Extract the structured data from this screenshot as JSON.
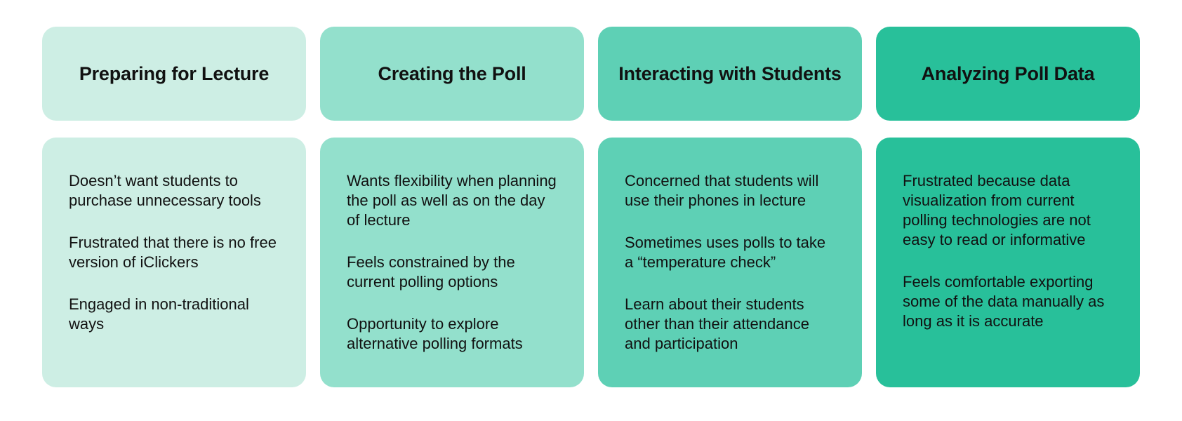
{
  "colors": {
    "stage_1": "#cdeee4",
    "stage_2": "#93e0cc",
    "stage_3": "#5ed0b5",
    "stage_4": "#28c09a"
  },
  "stages": [
    {
      "title": "Preparing for Lecture",
      "notes": [
        "Doesn’t want students to purchase unnecessary tools",
        "Frustrated that there is no free version of iClickers",
        "Engaged in non-traditional ways"
      ]
    },
    {
      "title": "Creating the Poll",
      "notes": [
        "Wants flexibility when planning the poll as well as on the day of lecture",
        "Feels constrained by the current polling options",
        "Opportunity to explore alternative polling formats"
      ]
    },
    {
      "title": "Interacting with Students",
      "notes": [
        "Concerned that students will use their phones in lecture",
        "Sometimes uses polls to take a “temperature check”",
        "Learn about their students other than their attendance and participation"
      ]
    },
    {
      "title": "Analyzing Poll Data",
      "notes": [
        "Frustrated because data visualization from current polling technologies are not easy to read or informative",
        "Feels comfortable exporting some of the data manually as long as it is accurate"
      ]
    }
  ]
}
